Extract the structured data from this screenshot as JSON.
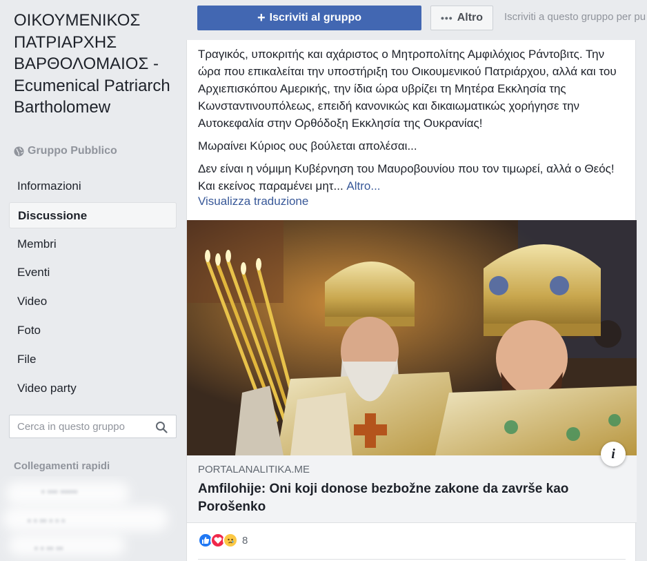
{
  "sidebar": {
    "group_title": "ΟΙΚΟΥΜΕΝΙΚΟΣ ΠΑΤΡΙΑΡΧΗΣ ΒΑΡΘΟΛΟΜΑΙΟΣ -Ecumenical Patriarch Bartholomew",
    "group_type": "Gruppo Pubblico",
    "group_type_icon": "globe-icon",
    "nav": [
      {
        "label": "Informazioni",
        "active": false
      },
      {
        "label": "Discussione",
        "active": true
      },
      {
        "label": "Membri",
        "active": false
      },
      {
        "label": "Eventi",
        "active": false
      },
      {
        "label": "Video",
        "active": false
      },
      {
        "label": "Foto",
        "active": false
      },
      {
        "label": "File",
        "active": false
      },
      {
        "label": "Video party",
        "active": false
      }
    ],
    "search_placeholder": "Cerca in questo gruppo",
    "quick_links_title": "Collegamenti rapidi"
  },
  "topbar": {
    "join_label": "Iscriviti al gruppo",
    "more_label": "Altro",
    "hint": "Iscriviti a questo gruppo per pu"
  },
  "post": {
    "paragraph1": "Τραγικός, υποκριτής και αχάριστος ο Μητροπολίτης Αμφιλόχιος Ράντοβιτς. Την ώρα που επικαλείται την υποστήριξη του Οικουμενικού Πατριάρχου, αλλά και του Αρχιεπισκόπου Αμερικής, την ίδια ώρα υβρίζει τη Μητέρα Εκκλησία της Κωνσταντινουπόλεως, επειδή κανονικώς και δικαιωματικώς χορήγησε την Αυτοκεφαλία στην Ορθόδοξη Εκκλησία της Ουκρανίας!",
    "paragraph2": "Μωραίνει Κύριος ους βούλεται απολέσαι...",
    "paragraph3": "Δεν είναι η νόμιμη Κυβέρνηση του Μαυροβουνίου που τον τιμωρεί, αλλά ο Θεός! Και εκείνος παραμένει μητ...",
    "more_link": "Altro...",
    "translate_link": "Visualizza traduzione",
    "link_domain": "PORTALANALITIKA.ME",
    "link_title": "Amfilohije: Oni koji donose bezbožne zakone da završe kao Porošenko",
    "reaction_count": "8",
    "reactions": [
      "like-icon",
      "love-icon",
      "sad-icon"
    ]
  },
  "colors": {
    "brand_blue": "#4267b2",
    "link_blue": "#385898",
    "background": "#e9ebee"
  }
}
